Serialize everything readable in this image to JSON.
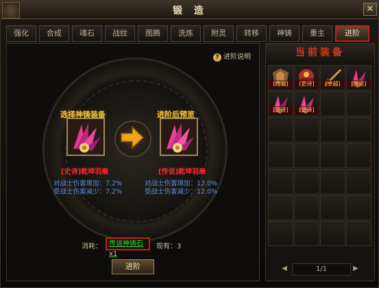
{
  "window": {
    "title": "锻 造",
    "close_label": "✕"
  },
  "tabs": [
    {
      "label": "强化"
    },
    {
      "label": "合成"
    },
    {
      "label": "魂石"
    },
    {
      "label": "战纹"
    },
    {
      "label": "图腾"
    },
    {
      "label": "洗炼"
    },
    {
      "label": "附灵"
    },
    {
      "label": "转移"
    },
    {
      "label": "神铸"
    },
    {
      "label": "重主"
    },
    {
      "label": "进阶",
      "active": true
    }
  ],
  "help_label": "进阶说明",
  "left": {
    "header": "选择神铸装备",
    "item_name": "[史诗]乾坤羽扇",
    "stats": [
      "对战士伤害增加：7.2%",
      "受战士伤害减少：7.2%"
    ]
  },
  "right": {
    "header": "进阶后预览",
    "item_name": "[传说]乾坤羽扇",
    "stats": [
      "对战士伤害增加：12.0%",
      "受战士伤害减少：12.0%"
    ]
  },
  "cost": {
    "label": "消耗：",
    "item": "传说神铸石",
    "qty": "x1",
    "have_label": "现有：3"
  },
  "advance_button": "进阶",
  "side": {
    "title": "当前装备",
    "items": [
      {
        "tag": "[传说]"
      },
      {
        "tag": "[史诗]"
      },
      {
        "tag": "[卓越]"
      },
      {
        "tag": "[传说]"
      },
      {
        "tag": "[史诗]"
      },
      {
        "tag": "[史诗]"
      }
    ],
    "page": "1/1"
  }
}
